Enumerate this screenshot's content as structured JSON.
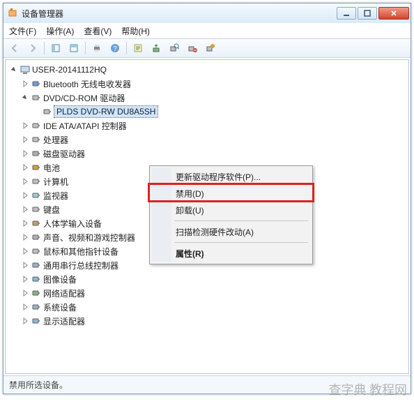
{
  "window": {
    "title": "设备管理器"
  },
  "menubar": {
    "file": "文件(F)",
    "action": "操作(A)",
    "view": "查看(V)",
    "help": "帮助(H)"
  },
  "tree": {
    "root": "USER-20141112HQ",
    "items": [
      {
        "label": "Bluetooth 无线电收发器"
      },
      {
        "label": "DVD/CD-ROM 驱动器",
        "expanded": true,
        "child": "PLDS DVD-RW DU8A5SH"
      },
      {
        "label": "IDE ATA/ATAPI 控制器"
      },
      {
        "label": "处理器"
      },
      {
        "label": "磁盘驱动器"
      },
      {
        "label": "电池"
      },
      {
        "label": "计算机"
      },
      {
        "label": "监视器"
      },
      {
        "label": "键盘"
      },
      {
        "label": "人体学输入设备"
      },
      {
        "label": "声音、视频和游戏控制器"
      },
      {
        "label": "鼠标和其他指针设备"
      },
      {
        "label": "通用串行总线控制器"
      },
      {
        "label": "图像设备"
      },
      {
        "label": "网络适配器"
      },
      {
        "label": "系统设备"
      },
      {
        "label": "显示适配器"
      }
    ]
  },
  "contextmenu": {
    "update": "更新驱动程序软件(P)...",
    "disable": "禁用(D)",
    "uninstall": "卸载(U)",
    "scan": "扫描检测硬件改动(A)",
    "properties": "属性(R)"
  },
  "statusbar": {
    "text": "禁用所选设备。"
  },
  "watermark": "查字典 教程网"
}
